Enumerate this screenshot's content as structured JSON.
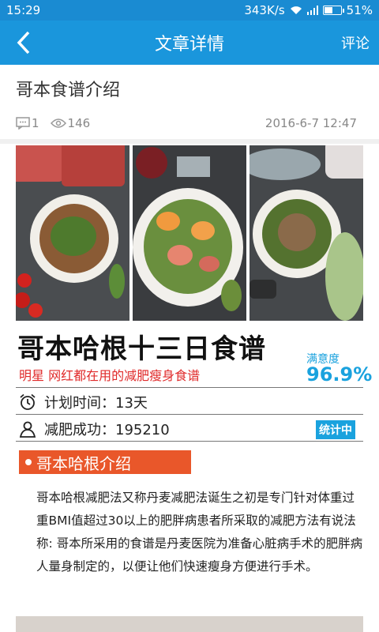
{
  "status_bar": {
    "time": "15:29",
    "speed": "343K/s",
    "battery": "51%"
  },
  "nav": {
    "title": "文章详情",
    "comment": "评论"
  },
  "article": {
    "title": "哥本食谱介绍",
    "comment_count": "1",
    "view_count": "146",
    "date": "2016-6-7 12:47"
  },
  "poster": {
    "title": "哥本哈根十三日食谱",
    "subtitle": "明星 网红都在用的减肥瘦身食谱",
    "satisfaction_label": "满意度",
    "satisfaction_value": "96.9%",
    "plan_label": "计划时间：13天",
    "success_label": "减肥成功：195210",
    "stats_badge": "统计中"
  },
  "section": {
    "heading": "哥本哈根介绍",
    "body": "哥本哈根减肥法又称丹麦减肥法诞生之初是专门针对体重过重BMI值超过30以上的肥胖病患者所采取的减肥方法有说法称: 哥本所采用的食谱是丹麦医院为准备心脏病手术的肥胖病人量身制定的，以便让他们快速瘦身方便进行手术。"
  },
  "colors": {
    "nav_bg": "#1a96dc",
    "accent": "#1aa2de",
    "section_bg": "#e9572a",
    "subtitle_red": "#e02a2a"
  },
  "icons": [
    "back-arrow-icon",
    "wifi-icon",
    "signal-icon",
    "battery-icon",
    "comment-icon",
    "eye-icon",
    "alarm-clock-icon",
    "person-icon"
  ]
}
